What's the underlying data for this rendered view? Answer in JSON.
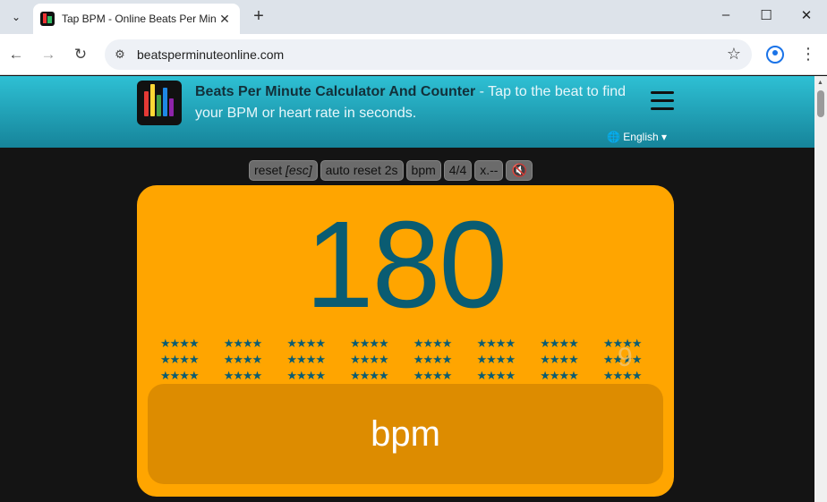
{
  "browser": {
    "tab_title": "Tap BPM - Online Beats Per Minute Counter",
    "url": "beatsperminuteonline.com"
  },
  "header": {
    "title": "Beats Per Minute Calculator And Counter",
    "tagline": " - Tap to the beat to find your BPM or heart rate in seconds.",
    "language": "English"
  },
  "controls": {
    "reset_label": "reset ",
    "reset_key": "[esc]",
    "auto_reset": "auto reset 2s",
    "unit": "bpm",
    "time_signature": "4/4",
    "multiplier": "x.--"
  },
  "display": {
    "bpm_value": "180",
    "star_row": "★★★★",
    "overlay_digit": "9",
    "tap_label": "bpm"
  },
  "colors": {
    "panel": "#ffa500",
    "tap_area": "#dd8c00",
    "value_text": "#0a5c72",
    "header_top": "#2ec0d4",
    "header_bottom": "#16849a"
  },
  "icons": {
    "sound": "mute-speaker-icon",
    "language": "globe-icon",
    "menu": "hamburger-menu-icon"
  }
}
